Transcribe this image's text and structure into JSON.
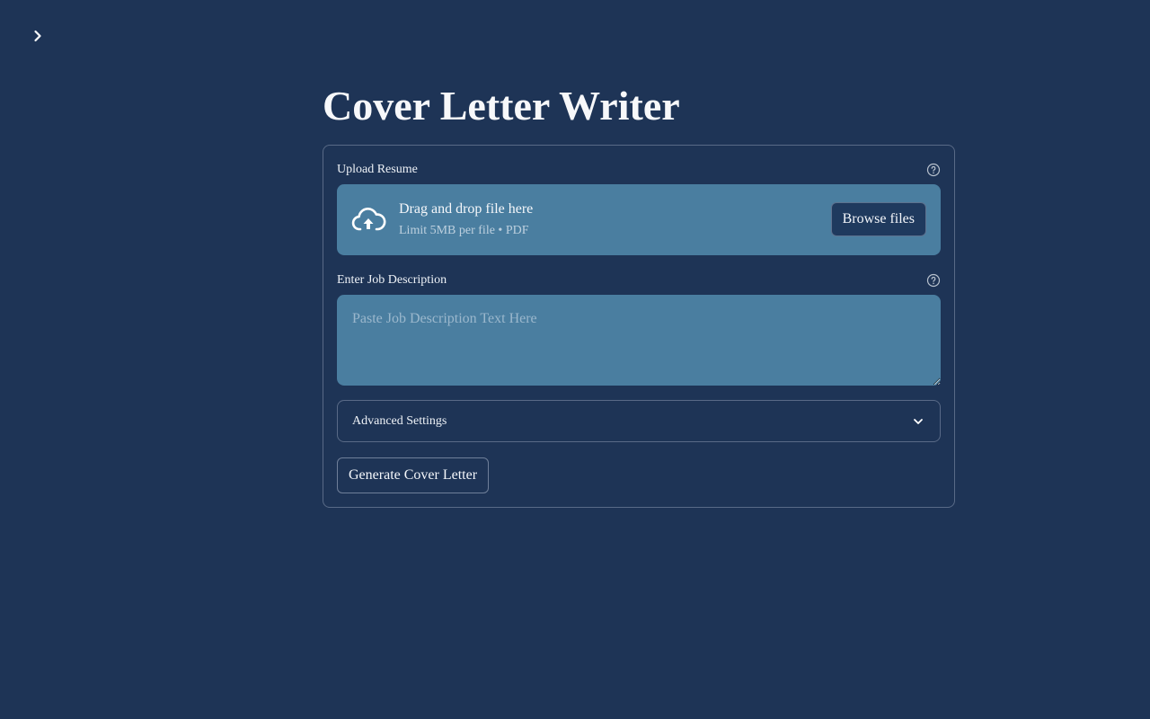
{
  "app": {
    "sidebar_toggle_icon": "chevron-right-icon",
    "title": "Cover Letter Writer"
  },
  "upload": {
    "label": "Upload Resume",
    "help_icon": "question-circle-icon",
    "dropzone_title": "Drag and drop file here",
    "dropzone_hint": "Limit 5MB per file • PDF",
    "upload_icon": "cloud-upload-icon",
    "browse_label": "Browse files"
  },
  "job": {
    "label": "Enter Job Description",
    "help_icon": "question-circle-icon",
    "value": "",
    "placeholder": "Paste Job Description Text Here"
  },
  "advanced": {
    "label": "Advanced Settings",
    "icon": "chevron-down-icon"
  },
  "actions": {
    "generate_label": "Generate Cover Letter"
  },
  "colors": {
    "background": "#1e3456",
    "input_fill": "#4a7ea0",
    "button_dark": "#1f3a5e",
    "text": "#f1f4f8"
  }
}
